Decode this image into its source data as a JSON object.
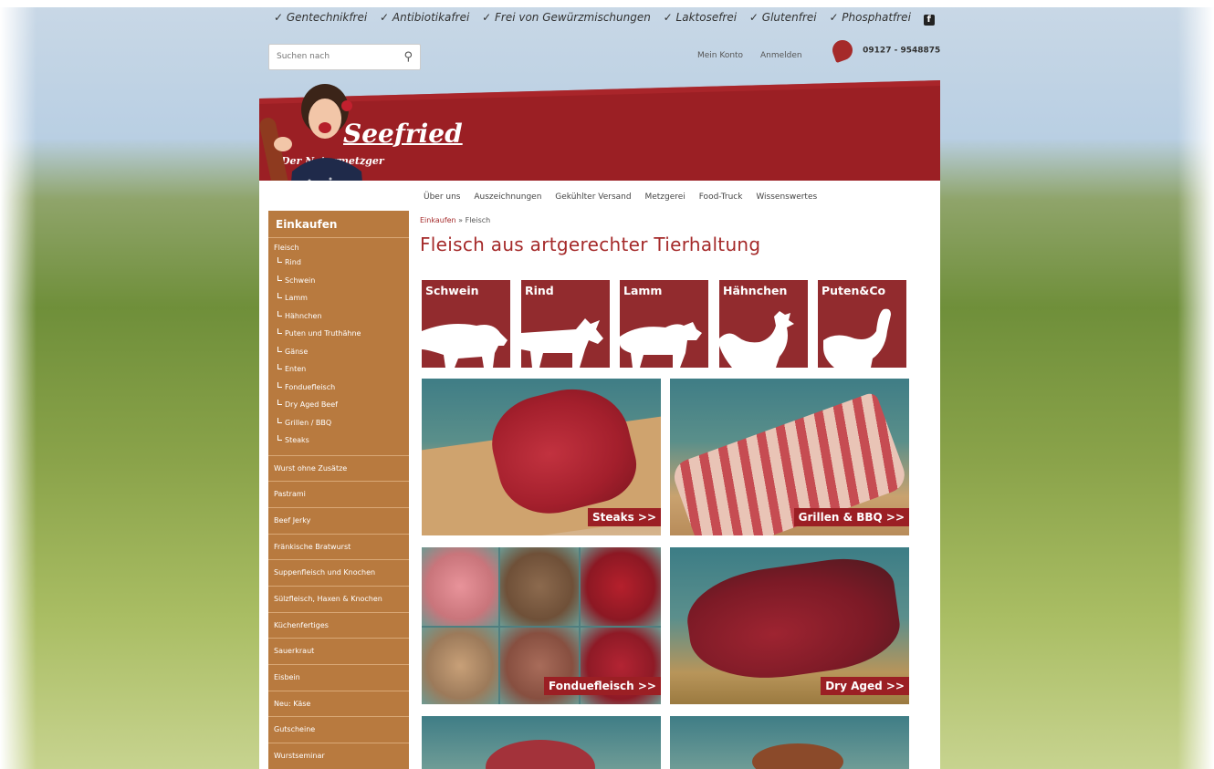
{
  "usp": {
    "items": [
      "✓ Gentechnikfrei",
      "✓ Antibiotikafrei",
      "✓ Frei von Gewürzmischungen",
      "✓ Laktosefrei",
      "✓ Glutenfrei",
      "✓ Phosphatfrei"
    ],
    "facebook_glyph": "f"
  },
  "search": {
    "placeholder": "Suchen nach",
    "icon": "search-icon"
  },
  "topnav": {
    "account": "Mein Konto",
    "login": "Anmelden",
    "phone": "09127 - 9548875"
  },
  "brand": {
    "logo": "Seefried",
    "tagline": "Der Naturmetzger",
    "color": "#9b1f24"
  },
  "mainnav": [
    "Über uns",
    "Auszeichnungen",
    "Gekühlter Versand",
    "Metzgerei",
    "Food-Truck",
    "Wissenswertes"
  ],
  "sidebar": {
    "title": "Einkaufen",
    "group": "Fleisch",
    "subitems": [
      "Rind",
      "Schwein",
      "Lamm",
      "Hähnchen",
      "Puten und Truthähne",
      "Gänse",
      "Enten",
      "Fonduefleisch",
      "Dry Aged Beef",
      "Grillen / BBQ",
      "Steaks"
    ],
    "items": [
      "Wurst ohne Zusätze",
      "Pastrami",
      "Beef Jerky",
      "Fränkische Bratwurst",
      "Suppenfleisch und Knochen",
      "Sülzfleisch, Haxen & Knochen",
      "Küchenfertiges",
      "Sauerkraut",
      "Eisbein",
      "Neu: Käse",
      "Gutscheine",
      "Wurstseminar"
    ],
    "color": "#b87a3f"
  },
  "breadcrumb": {
    "first": "Einkaufen",
    "sep": " » ",
    "current": "Fleisch"
  },
  "heading": "Fleisch aus artgerechter Tierhaltung",
  "categories": [
    "Schwein",
    "Rind",
    "Lamm",
    "Hähnchen",
    "Puten&Co"
  ],
  "tiles": [
    "Steaks >>",
    "Grillen & BBQ >>",
    "Fonduefleisch >>",
    "Dry Aged >>"
  ]
}
